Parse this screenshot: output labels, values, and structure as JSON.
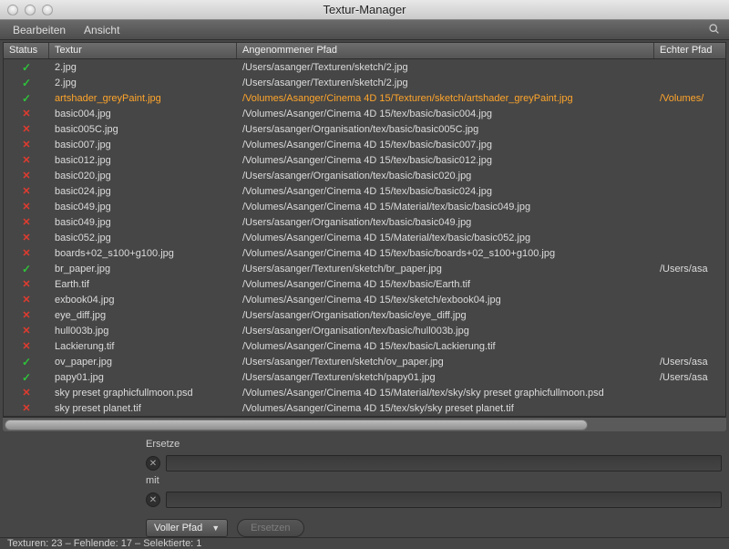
{
  "window": {
    "title": "Textur-Manager"
  },
  "menubar": {
    "edit": "Bearbeiten",
    "view": "Ansicht"
  },
  "columns": {
    "status": "Status",
    "texture": "Textur",
    "assumed_path": "Angenommener Pfad",
    "real_path": "Echter Pfad"
  },
  "rows": [
    {
      "status": "ok",
      "sel": false,
      "texture": "2.jpg",
      "path": "/Users/asanger/Texturen/sketch/2.jpg",
      "real": ""
    },
    {
      "status": "ok",
      "sel": false,
      "texture": "2.jpg",
      "path": "/Users/asanger/Texturen/sketch/2.jpg",
      "real": ""
    },
    {
      "status": "ok",
      "sel": true,
      "texture": "artshader_greyPaint.jpg",
      "path": "/Volumes/Asanger/Cinema 4D 15/Texturen/sketch/artshader_greyPaint.jpg",
      "real": "/Volumes/"
    },
    {
      "status": "miss",
      "sel": false,
      "texture": "basic004.jpg",
      "path": "/Volumes/Asanger/Cinema 4D 15/tex/basic/basic004.jpg",
      "real": ""
    },
    {
      "status": "miss",
      "sel": false,
      "texture": "basic005C.jpg",
      "path": "/Users/asanger/Organisation/tex/basic/basic005C.jpg",
      "real": ""
    },
    {
      "status": "miss",
      "sel": false,
      "texture": "basic007.jpg",
      "path": "/Volumes/Asanger/Cinema 4D 15/tex/basic/basic007.jpg",
      "real": ""
    },
    {
      "status": "miss",
      "sel": false,
      "texture": "basic012.jpg",
      "path": "/Volumes/Asanger/Cinema 4D 15/tex/basic/basic012.jpg",
      "real": ""
    },
    {
      "status": "miss",
      "sel": false,
      "texture": "basic020.jpg",
      "path": "/Users/asanger/Organisation/tex/basic/basic020.jpg",
      "real": ""
    },
    {
      "status": "miss",
      "sel": false,
      "texture": "basic024.jpg",
      "path": "/Volumes/Asanger/Cinema 4D 15/tex/basic/basic024.jpg",
      "real": ""
    },
    {
      "status": "miss",
      "sel": false,
      "texture": "basic049.jpg",
      "path": "/Volumes/Asanger/Cinema 4D 15/Material/tex/basic/basic049.jpg",
      "real": ""
    },
    {
      "status": "miss",
      "sel": false,
      "texture": "basic049.jpg",
      "path": "/Users/asanger/Organisation/tex/basic/basic049.jpg",
      "real": ""
    },
    {
      "status": "miss",
      "sel": false,
      "texture": "basic052.jpg",
      "path": "/Volumes/Asanger/Cinema 4D 15/Material/tex/basic/basic052.jpg",
      "real": ""
    },
    {
      "status": "miss",
      "sel": false,
      "texture": "boards+02_s100+g100.jpg",
      "path": "/Volumes/Asanger/Cinema 4D 15/tex/basic/boards+02_s100+g100.jpg",
      "real": ""
    },
    {
      "status": "ok",
      "sel": false,
      "texture": "br_paper.jpg",
      "path": "/Users/asanger/Texturen/sketch/br_paper.jpg",
      "real": "/Users/asa"
    },
    {
      "status": "miss",
      "sel": false,
      "texture": "Earth.tif",
      "path": "/Volumes/Asanger/Cinema 4D 15/tex/basic/Earth.tif",
      "real": ""
    },
    {
      "status": "miss",
      "sel": false,
      "texture": "exbook04.jpg",
      "path": "/Volumes/Asanger/Cinema 4D 15/tex/sketch/exbook04.jpg",
      "real": ""
    },
    {
      "status": "miss",
      "sel": false,
      "texture": "eye_diff.jpg",
      "path": "/Users/asanger/Organisation/tex/basic/eye_diff.jpg",
      "real": ""
    },
    {
      "status": "miss",
      "sel": false,
      "texture": "hull003b.jpg",
      "path": "/Users/asanger/Organisation/tex/basic/hull003b.jpg",
      "real": ""
    },
    {
      "status": "miss",
      "sel": false,
      "texture": "Lackierung.tif",
      "path": "/Volumes/Asanger/Cinema 4D 15/tex/basic/Lackierung.tif",
      "real": ""
    },
    {
      "status": "ok",
      "sel": false,
      "texture": "ov_paper.jpg",
      "path": "/Users/asanger/Texturen/sketch/ov_paper.jpg",
      "real": "/Users/asa"
    },
    {
      "status": "ok",
      "sel": false,
      "texture": "papy01.jpg",
      "path": "/Users/asanger/Texturen/sketch/papy01.jpg",
      "real": "/Users/asa"
    },
    {
      "status": "miss",
      "sel": false,
      "texture": "sky preset graphicfullmoon.psd",
      "path": "/Volumes/Asanger/Cinema 4D 15/Material/tex/sky/sky preset graphicfullmoon.psd",
      "real": ""
    },
    {
      "status": "miss",
      "sel": false,
      "texture": "sky preset planet.tif",
      "path": "/Volumes/Asanger/Cinema 4D 15/tex/sky/sky preset planet.tif",
      "real": ""
    }
  ],
  "replace_panel": {
    "replace_label": "Ersetze",
    "with_label": "mit",
    "dropdown_value": "Voller Pfad",
    "button_label": "Ersetzen"
  },
  "statusbar": "Texturen: 23 – Fehlende: 17 – Selektierte: 1"
}
